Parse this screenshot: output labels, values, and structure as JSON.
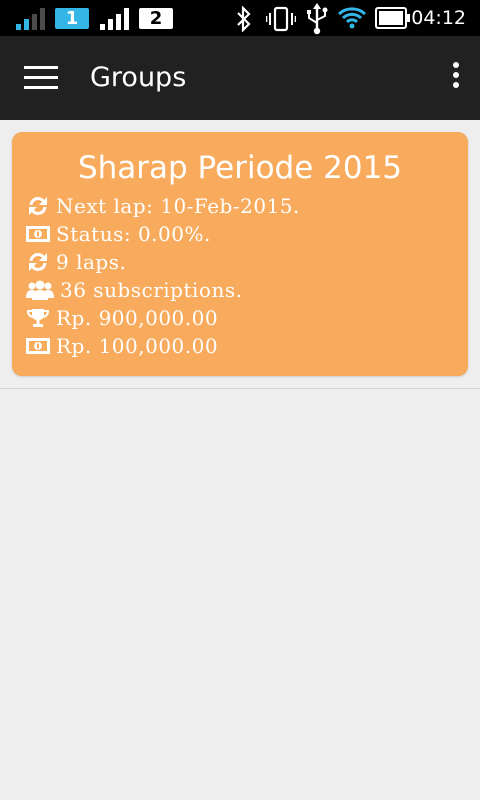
{
  "status_bar": {
    "sim1_label": "1",
    "sim2_label": "2",
    "time": "04:12",
    "icons": [
      "signal-icon-sim1",
      "signal-icon-sim2",
      "bluetooth-icon",
      "vibrate-icon",
      "usb-icon",
      "wifi-icon",
      "battery-icon"
    ]
  },
  "app_bar": {
    "title": "Groups",
    "menu_icon": "hamburger-menu-icon",
    "overflow_icon": "overflow-menu-icon"
  },
  "groups": [
    {
      "title": "Sharap Periode 2015",
      "rows": [
        {
          "icon": "refresh-icon",
          "text": "Next lap: 10-Feb-2015."
        },
        {
          "icon": "money-icon",
          "text": "Status: 0.00%."
        },
        {
          "icon": "refresh-icon",
          "text": "9 laps."
        },
        {
          "icon": "users-icon",
          "text": "36 subscriptions."
        },
        {
          "icon": "trophy-icon",
          "text": "Rp. 900,000.00"
        },
        {
          "icon": "money-icon",
          "text": "Rp. 100,000.00"
        }
      ]
    }
  ],
  "colors": {
    "status_bar_bg": "#000000",
    "app_bar_bg": "#212121",
    "card_bg": "#f8ab5c",
    "page_bg": "#eeeeee",
    "sim1_accent": "#33b5e5"
  }
}
